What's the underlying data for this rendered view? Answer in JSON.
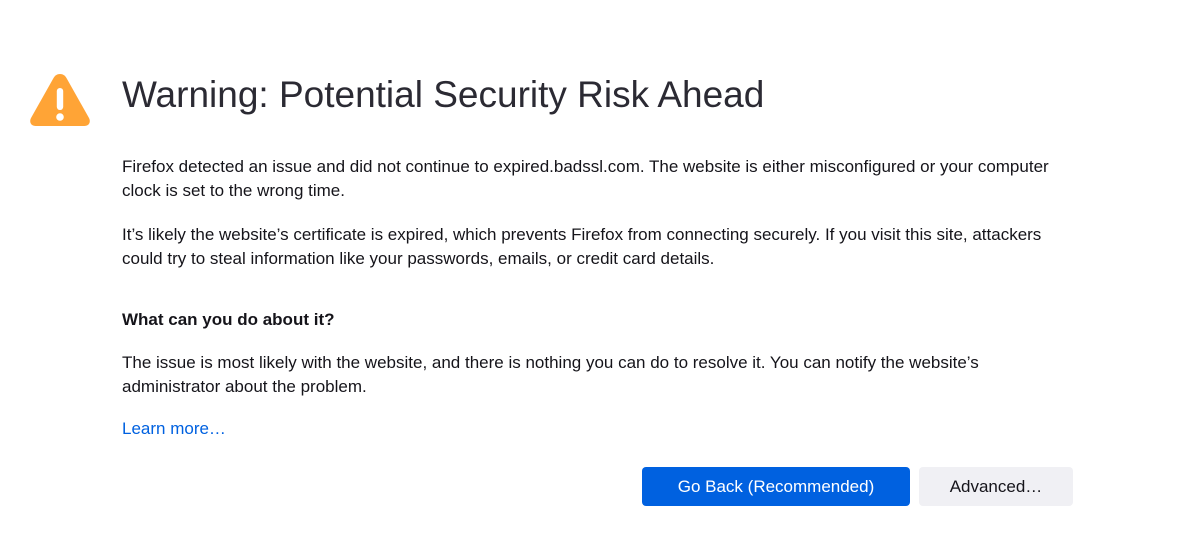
{
  "error_page": {
    "icon": "warning-triangle-icon",
    "icon_color": "#ffa436",
    "title": "Warning: Potential Security Risk Ahead",
    "intro": "Firefox detected an issue and did not continue to expired.badssl.com. The website is either misconfigured or your computer clock is set to the wrong time.",
    "explanation": "It’s likely the website’s certificate is expired, which prevents Firefox from connecting securely. If you visit this site, attackers could try to steal information like your passwords, emails, or credit card details.",
    "what_can_you_do_heading": "What can you do about it?",
    "what_can_you_do_text": "The issue is most likely with the website, and there is nothing you can do to resolve it. You can notify the website’s administrator about the problem.",
    "learn_more_label": "Learn more…",
    "go_back_label": "Go Back (Recommended)",
    "advanced_label": "Advanced…",
    "accent_color": "#0061e0"
  }
}
